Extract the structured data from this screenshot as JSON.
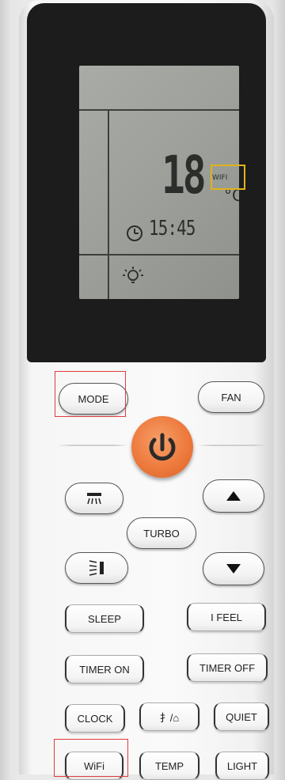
{
  "display": {
    "temperature": "18",
    "unit": "°C",
    "wifi_indicator": "WIFI",
    "clock_time": "15:45"
  },
  "buttons": {
    "mode": "MODE",
    "fan": "FAN",
    "turbo": "TURBO",
    "sleep": "SLEEP",
    "i_feel": "I FEEL",
    "timer_on": "TIMER ON",
    "timer_off": "TIMER OFF",
    "clock": "CLOCK",
    "health": "⺘/⌂",
    "quiet": "QUIET",
    "wifi": "WiFi",
    "temp": "TEMP",
    "light": "LIGHT"
  },
  "colors": {
    "power_button": "#ee7a3d",
    "highlight_red": "#e23b3b",
    "highlight_yellow": "#e0b21c"
  },
  "icons": {
    "power": "power-icon",
    "swing_vertical": "swing-vertical-icon",
    "swing_horizontal": "swing-horizontal-icon",
    "up": "triangle-up-icon",
    "down": "triangle-down-icon",
    "clock": "clock-icon",
    "light": "light-bulb-icon"
  }
}
